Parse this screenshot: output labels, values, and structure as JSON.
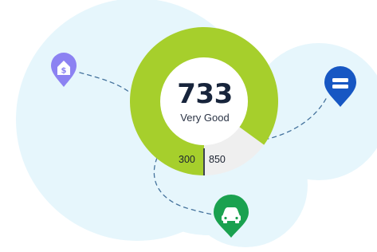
{
  "score": {
    "value": "733",
    "rating": "Very Good",
    "range_min": "300",
    "range_max": "850",
    "fill_fraction": 0.85
  },
  "icons": [
    {
      "name": "house-dollar-icon",
      "color": "#8c82f2"
    },
    {
      "name": "credit-card-icon",
      "color": "#1757c3"
    },
    {
      "name": "car-icon",
      "color": "#1aa14f"
    }
  ],
  "colors": {
    "gauge_fill": "#a6cf2c",
    "gauge_track": "#efefef",
    "background_blob": "#e6f6fc",
    "dashed_path": "#44729c"
  }
}
